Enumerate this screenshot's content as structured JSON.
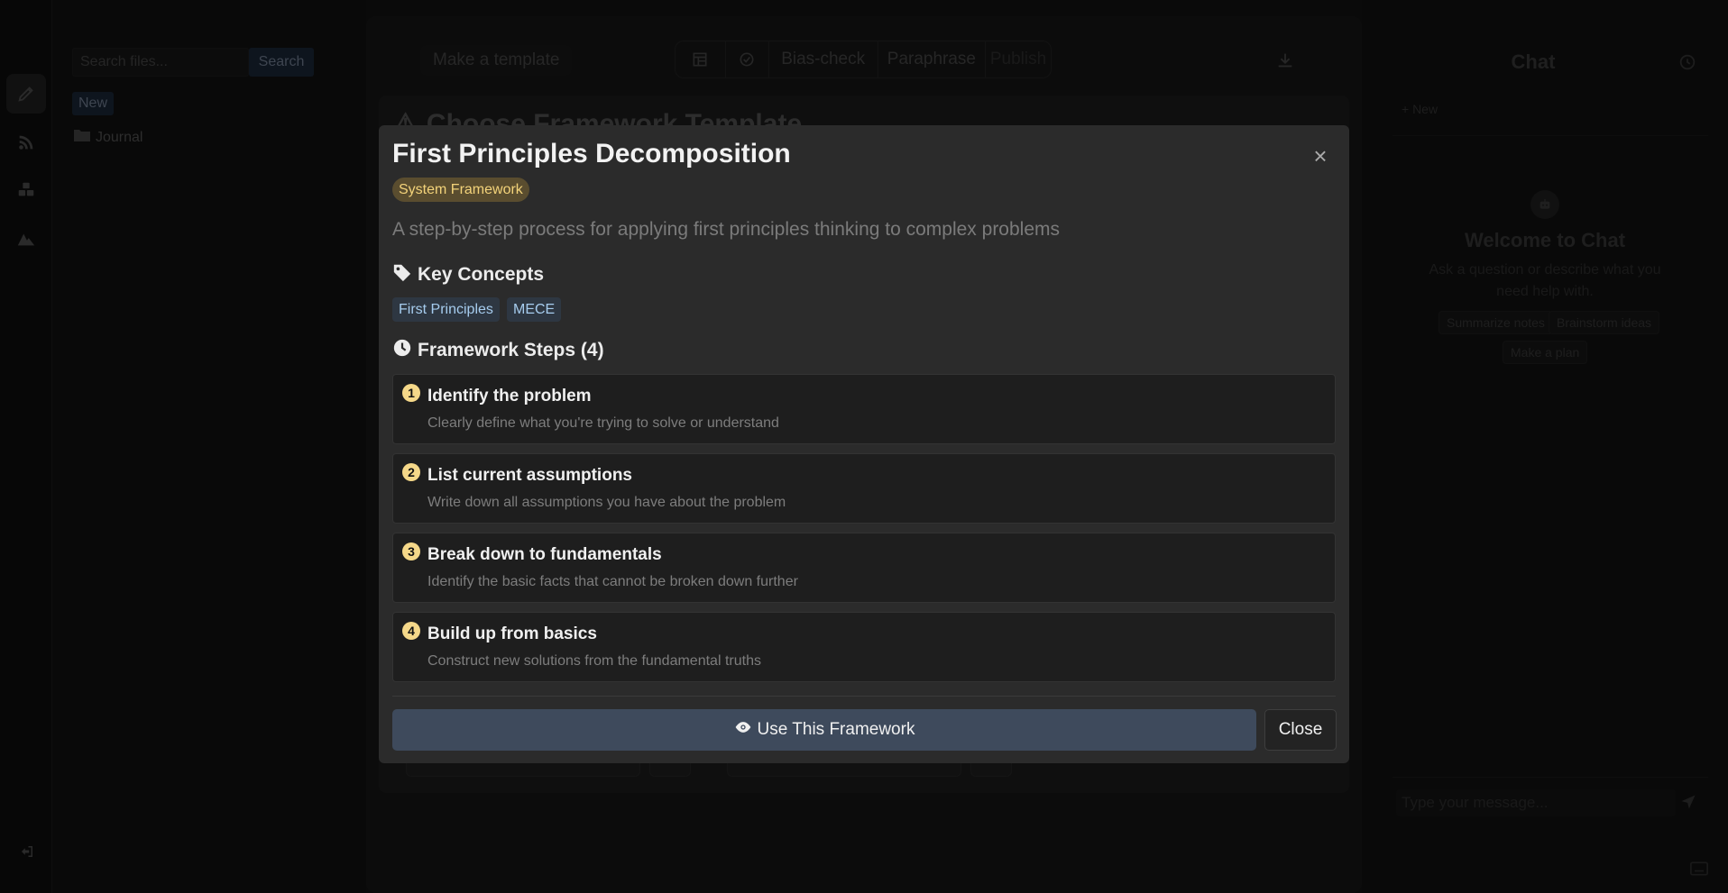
{
  "sidebar": {
    "icons": [
      "pencil-icon",
      "rss-icon",
      "boxes-icon",
      "mountain-icon"
    ],
    "logout_icon": "logout-icon"
  },
  "files": {
    "search_placeholder": "Search files...",
    "search_label": "Search",
    "new_label": "New",
    "folders": [
      {
        "name": "Journal"
      }
    ]
  },
  "editor": {
    "make_template_label": "Make a template",
    "toolbar": {
      "bias_check": "Bias-check",
      "paraphrase": "Paraphrase",
      "publish": "Publish"
    },
    "template_card_title": "Choose Framework Template"
  },
  "chat": {
    "title": "Chat",
    "new_label": "+ New",
    "welcome_title": "Welcome to Chat",
    "welcome_sub": "Ask a question or describe what you need help with.",
    "suggestions": [
      "Summarize notes",
      "Brainstorm ideas",
      "Make a plan"
    ],
    "input_placeholder": "Type your message..."
  },
  "modal": {
    "title": "First Principles Decomposition",
    "badge": "System Framework",
    "description": "A step-by-step process for applying first principles thinking to complex problems",
    "key_concepts_heading": "Key Concepts",
    "concepts": [
      "First Principles",
      "MECE"
    ],
    "steps_heading": "Framework Steps (4)",
    "steps": [
      {
        "num": "1",
        "title": "Identify the problem",
        "desc": "Clearly define what you're trying to solve or understand"
      },
      {
        "num": "2",
        "title": "List current assumptions",
        "desc": "Write down all assumptions you have about the problem"
      },
      {
        "num": "3",
        "title": "Break down to fundamentals",
        "desc": "Identify the basic facts that cannot be broken down further"
      },
      {
        "num": "4",
        "title": "Build up from basics",
        "desc": "Construct new solutions from the fundamental truths"
      }
    ],
    "use_button": "Use This Framework",
    "close_button": "Close",
    "close_icon": "×"
  },
  "colors": {
    "badge_bg": "#5a4d2f",
    "badge_text": "#f3d37a",
    "concept_bg": "#2e3742",
    "concept_text": "#a6ccee",
    "step_number_bg": "#f5d889",
    "primary_button": "#3e4a5c"
  }
}
